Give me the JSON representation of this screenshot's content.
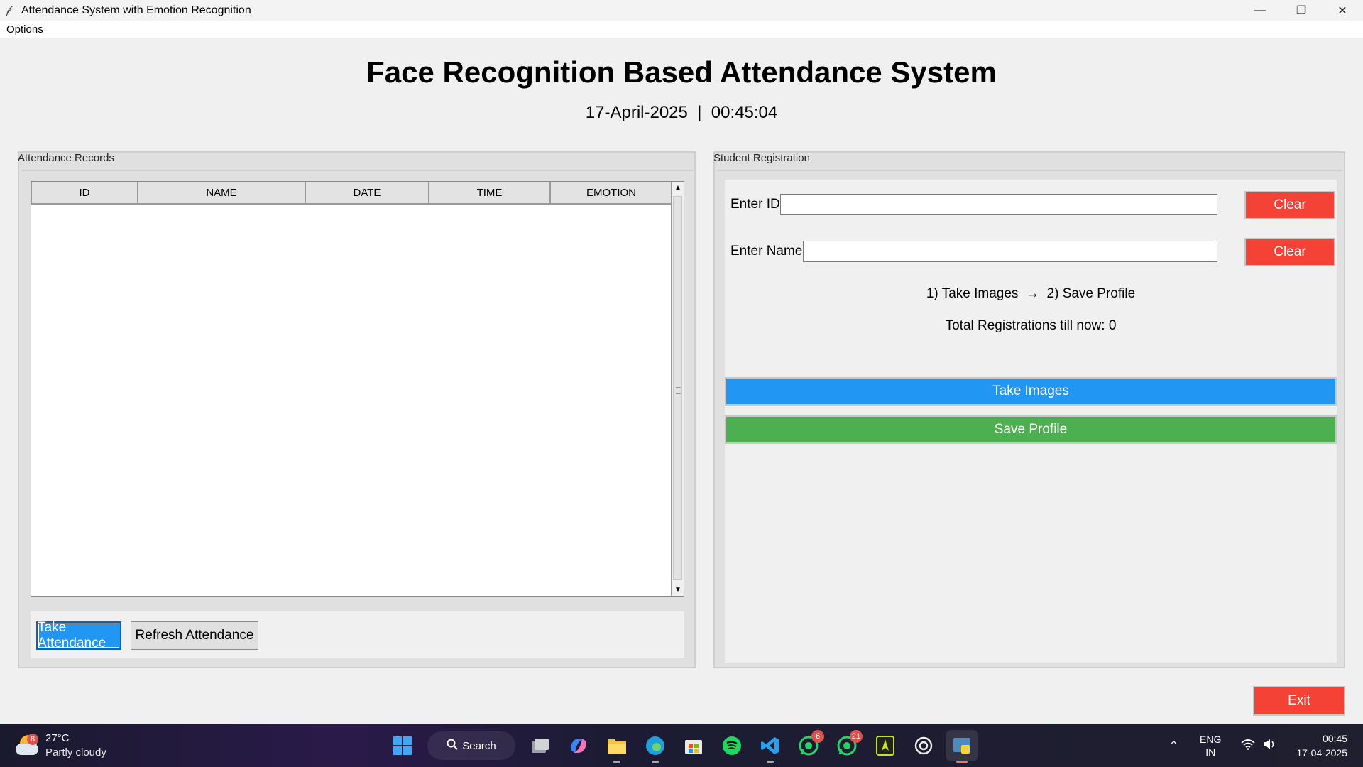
{
  "window": {
    "title": "Attendance System with Emotion Recognition",
    "minimize": "—",
    "maximize": "❐",
    "close": "✕"
  },
  "menu": {
    "options": "Options"
  },
  "header": {
    "title": "Face Recognition Based Attendance System",
    "date": "17-April-2025",
    "separator": "  |  ",
    "time": "00:45:04"
  },
  "attendance": {
    "panel_label": "Attendance Records",
    "columns": [
      "ID",
      "NAME",
      "DATE",
      "TIME",
      "EMOTION"
    ],
    "rows": [],
    "take_attendance": "Take Attendance",
    "refresh_attendance": "Refresh Attendance"
  },
  "registration": {
    "panel_label": "Student Registration",
    "id_label": "Enter ID:",
    "id_value": "",
    "name_label": "Enter Name:",
    "name_value": "",
    "clear_label": "Clear",
    "steps": "1) Take Images  →  2) Save Profile",
    "total": "Total Registrations till now: 0",
    "take_images": "Take Images",
    "save_profile": "Save Profile"
  },
  "exit_label": "Exit",
  "colors": {
    "blue": "#2196f3",
    "green": "#4caf50",
    "red": "#f44336"
  },
  "taskbar": {
    "weather_temp": "27°C",
    "weather_cond": "Partly cloudy",
    "weather_badge": "8",
    "search": "Search",
    "whatsapp_badge": "6",
    "whatsapp2_badge": "21",
    "lang1": "ENG",
    "lang2": "IN",
    "clock_time": "00:45",
    "clock_date": "17-04-2025"
  }
}
